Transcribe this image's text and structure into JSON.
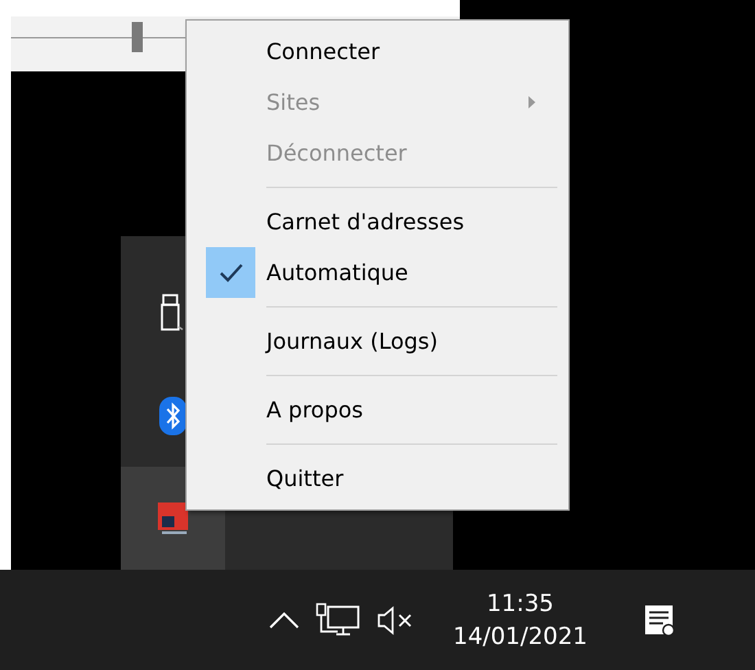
{
  "slider": {
    "level": 0.28
  },
  "tray_overflow": {
    "icons": [
      {
        "kind": "usb",
        "selected": false
      },
      {
        "kind": "bluetooth",
        "selected": false
      },
      {
        "kind": "app",
        "selected": true
      }
    ]
  },
  "context_menu": {
    "items": [
      {
        "kind": "item",
        "label": "Connecter",
        "disabled": false,
        "checked": false,
        "submenu": false
      },
      {
        "kind": "item",
        "label": "Sites",
        "disabled": true,
        "checked": false,
        "submenu": true
      },
      {
        "kind": "item",
        "label": "Déconnecter",
        "disabled": true,
        "checked": false,
        "submenu": false
      },
      {
        "kind": "separator"
      },
      {
        "kind": "item",
        "label": "Carnet d'adresses",
        "disabled": false,
        "checked": false,
        "submenu": false
      },
      {
        "kind": "item",
        "label": "Automatique",
        "disabled": false,
        "checked": true,
        "submenu": false
      },
      {
        "kind": "separator"
      },
      {
        "kind": "item",
        "label": "Journaux (Logs)",
        "disabled": false,
        "checked": false,
        "submenu": false
      },
      {
        "kind": "separator"
      },
      {
        "kind": "item",
        "label": "A propos",
        "disabled": false,
        "checked": false,
        "submenu": false
      },
      {
        "kind": "separator"
      },
      {
        "kind": "item",
        "label": "Quitter",
        "disabled": false,
        "checked": false,
        "submenu": false
      }
    ]
  },
  "taskbar": {
    "time": "11:35",
    "date": "14/01/2021",
    "volume_muted": true
  }
}
